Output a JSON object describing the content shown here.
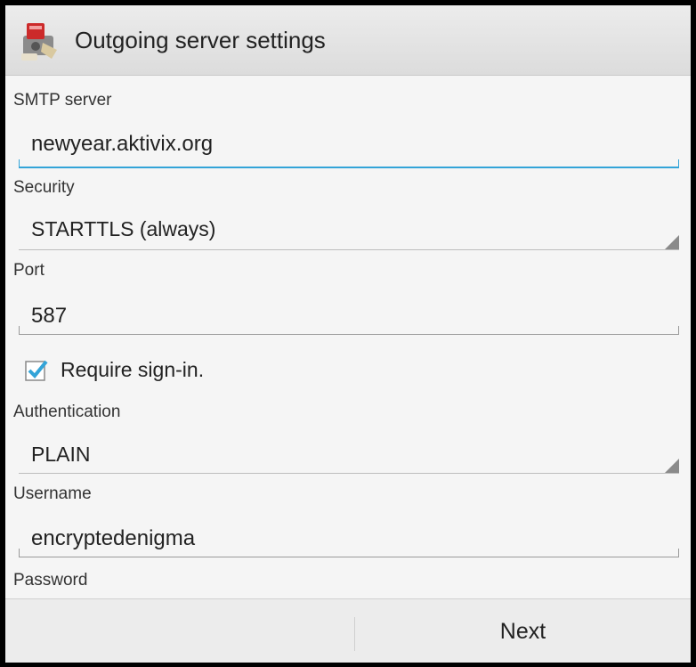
{
  "header": {
    "title": "Outgoing server settings",
    "icon": "mail-app-icon"
  },
  "form": {
    "smtp_server": {
      "label": "SMTP server",
      "value": "newyear.aktivix.org"
    },
    "security": {
      "label": "Security",
      "value": "STARTTLS (always)"
    },
    "port": {
      "label": "Port",
      "value": "587"
    },
    "require_signin": {
      "label": "Require sign-in.",
      "checked": true
    },
    "authentication": {
      "label": "Authentication",
      "value": "PLAIN"
    },
    "username": {
      "label": "Username",
      "value": "encryptedenigma"
    },
    "password": {
      "label": "Password"
    }
  },
  "footer": {
    "next_label": "Next"
  },
  "colors": {
    "accent": "#33a4d8",
    "background": "#f5f5f5"
  }
}
